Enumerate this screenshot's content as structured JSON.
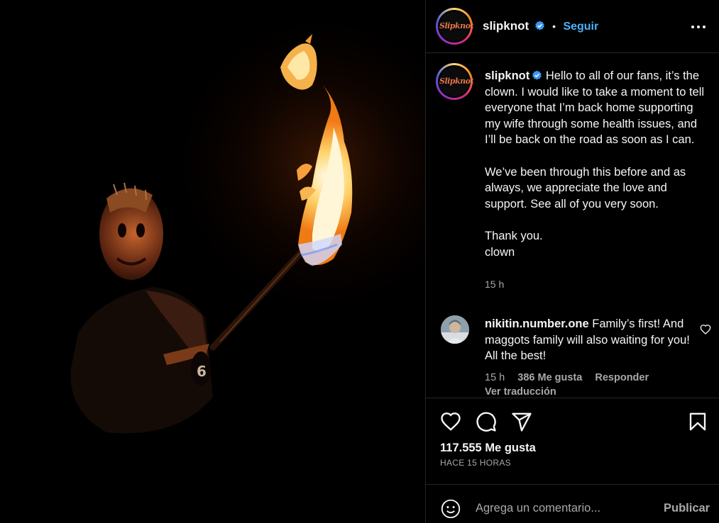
{
  "post": {
    "username": "slipknot",
    "avatar_text": "Slipknot",
    "follow_label": "Seguir",
    "separator": "•",
    "more_icon": "more-horizontal-icon",
    "caption": "Hello to all of our fans, it’s the clown. I would like to take a moment to tell everyone that I’m back home supporting my wife through some health issues, and I’ll be back on the road as soon as I can.\n\nWe’ve been through this before and as always, we appreciate the love and support. See all of you very soon.\n\nThank you.\nclown",
    "caption_time": "15 h"
  },
  "comment": {
    "username": "nikitin.number.one",
    "text": "Family’s first! And maggots family will also waiting for you! All the best!",
    "time": "15 h",
    "likes": "386 Me gusta",
    "reply_label": "Responder",
    "translate_label": "Ver traducción"
  },
  "actions": {
    "likes": "117.555 Me gusta",
    "posted_ago": "HACE 15 HORAS"
  },
  "composer": {
    "placeholder": "Agrega un comentario...",
    "publish_label": "Publicar"
  },
  "colors": {
    "background": "#000000",
    "accent": "#4db1f7",
    "muted": "#a8a8a8",
    "divider": "#262626"
  }
}
